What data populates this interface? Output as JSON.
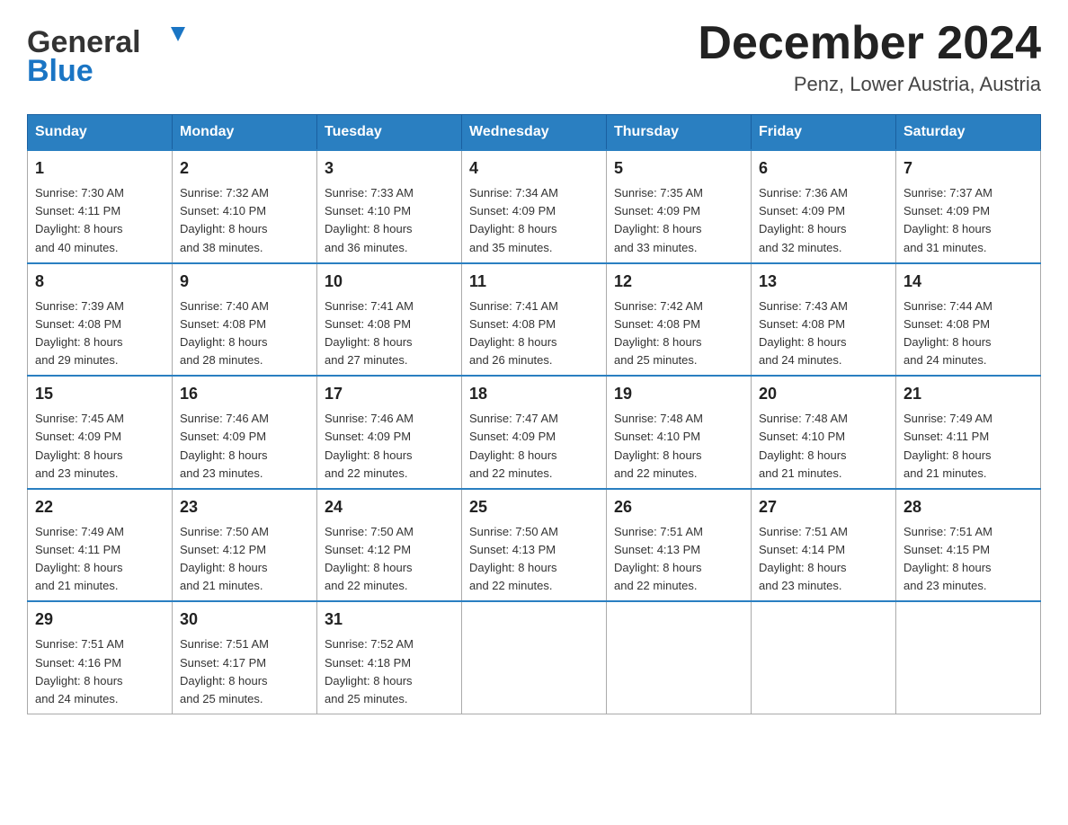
{
  "header": {
    "logo_line1": "General",
    "logo_line2": "Blue",
    "month_title": "December 2024",
    "location": "Penz, Lower Austria, Austria"
  },
  "weekdays": [
    "Sunday",
    "Monday",
    "Tuesday",
    "Wednesday",
    "Thursday",
    "Friday",
    "Saturday"
  ],
  "weeks": [
    [
      {
        "day": "1",
        "info": "Sunrise: 7:30 AM\nSunset: 4:11 PM\nDaylight: 8 hours\nand 40 minutes."
      },
      {
        "day": "2",
        "info": "Sunrise: 7:32 AM\nSunset: 4:10 PM\nDaylight: 8 hours\nand 38 minutes."
      },
      {
        "day": "3",
        "info": "Sunrise: 7:33 AM\nSunset: 4:10 PM\nDaylight: 8 hours\nand 36 minutes."
      },
      {
        "day": "4",
        "info": "Sunrise: 7:34 AM\nSunset: 4:09 PM\nDaylight: 8 hours\nand 35 minutes."
      },
      {
        "day": "5",
        "info": "Sunrise: 7:35 AM\nSunset: 4:09 PM\nDaylight: 8 hours\nand 33 minutes."
      },
      {
        "day": "6",
        "info": "Sunrise: 7:36 AM\nSunset: 4:09 PM\nDaylight: 8 hours\nand 32 minutes."
      },
      {
        "day": "7",
        "info": "Sunrise: 7:37 AM\nSunset: 4:09 PM\nDaylight: 8 hours\nand 31 minutes."
      }
    ],
    [
      {
        "day": "8",
        "info": "Sunrise: 7:39 AM\nSunset: 4:08 PM\nDaylight: 8 hours\nand 29 minutes."
      },
      {
        "day": "9",
        "info": "Sunrise: 7:40 AM\nSunset: 4:08 PM\nDaylight: 8 hours\nand 28 minutes."
      },
      {
        "day": "10",
        "info": "Sunrise: 7:41 AM\nSunset: 4:08 PM\nDaylight: 8 hours\nand 27 minutes."
      },
      {
        "day": "11",
        "info": "Sunrise: 7:41 AM\nSunset: 4:08 PM\nDaylight: 8 hours\nand 26 minutes."
      },
      {
        "day": "12",
        "info": "Sunrise: 7:42 AM\nSunset: 4:08 PM\nDaylight: 8 hours\nand 25 minutes."
      },
      {
        "day": "13",
        "info": "Sunrise: 7:43 AM\nSunset: 4:08 PM\nDaylight: 8 hours\nand 24 minutes."
      },
      {
        "day": "14",
        "info": "Sunrise: 7:44 AM\nSunset: 4:08 PM\nDaylight: 8 hours\nand 24 minutes."
      }
    ],
    [
      {
        "day": "15",
        "info": "Sunrise: 7:45 AM\nSunset: 4:09 PM\nDaylight: 8 hours\nand 23 minutes."
      },
      {
        "day": "16",
        "info": "Sunrise: 7:46 AM\nSunset: 4:09 PM\nDaylight: 8 hours\nand 23 minutes."
      },
      {
        "day": "17",
        "info": "Sunrise: 7:46 AM\nSunset: 4:09 PM\nDaylight: 8 hours\nand 22 minutes."
      },
      {
        "day": "18",
        "info": "Sunrise: 7:47 AM\nSunset: 4:09 PM\nDaylight: 8 hours\nand 22 minutes."
      },
      {
        "day": "19",
        "info": "Sunrise: 7:48 AM\nSunset: 4:10 PM\nDaylight: 8 hours\nand 22 minutes."
      },
      {
        "day": "20",
        "info": "Sunrise: 7:48 AM\nSunset: 4:10 PM\nDaylight: 8 hours\nand 21 minutes."
      },
      {
        "day": "21",
        "info": "Sunrise: 7:49 AM\nSunset: 4:11 PM\nDaylight: 8 hours\nand 21 minutes."
      }
    ],
    [
      {
        "day": "22",
        "info": "Sunrise: 7:49 AM\nSunset: 4:11 PM\nDaylight: 8 hours\nand 21 minutes."
      },
      {
        "day": "23",
        "info": "Sunrise: 7:50 AM\nSunset: 4:12 PM\nDaylight: 8 hours\nand 21 minutes."
      },
      {
        "day": "24",
        "info": "Sunrise: 7:50 AM\nSunset: 4:12 PM\nDaylight: 8 hours\nand 22 minutes."
      },
      {
        "day": "25",
        "info": "Sunrise: 7:50 AM\nSunset: 4:13 PM\nDaylight: 8 hours\nand 22 minutes."
      },
      {
        "day": "26",
        "info": "Sunrise: 7:51 AM\nSunset: 4:13 PM\nDaylight: 8 hours\nand 22 minutes."
      },
      {
        "day": "27",
        "info": "Sunrise: 7:51 AM\nSunset: 4:14 PM\nDaylight: 8 hours\nand 23 minutes."
      },
      {
        "day": "28",
        "info": "Sunrise: 7:51 AM\nSunset: 4:15 PM\nDaylight: 8 hours\nand 23 minutes."
      }
    ],
    [
      {
        "day": "29",
        "info": "Sunrise: 7:51 AM\nSunset: 4:16 PM\nDaylight: 8 hours\nand 24 minutes."
      },
      {
        "day": "30",
        "info": "Sunrise: 7:51 AM\nSunset: 4:17 PM\nDaylight: 8 hours\nand 25 minutes."
      },
      {
        "day": "31",
        "info": "Sunrise: 7:52 AM\nSunset: 4:18 PM\nDaylight: 8 hours\nand 25 minutes."
      },
      null,
      null,
      null,
      null
    ]
  ]
}
